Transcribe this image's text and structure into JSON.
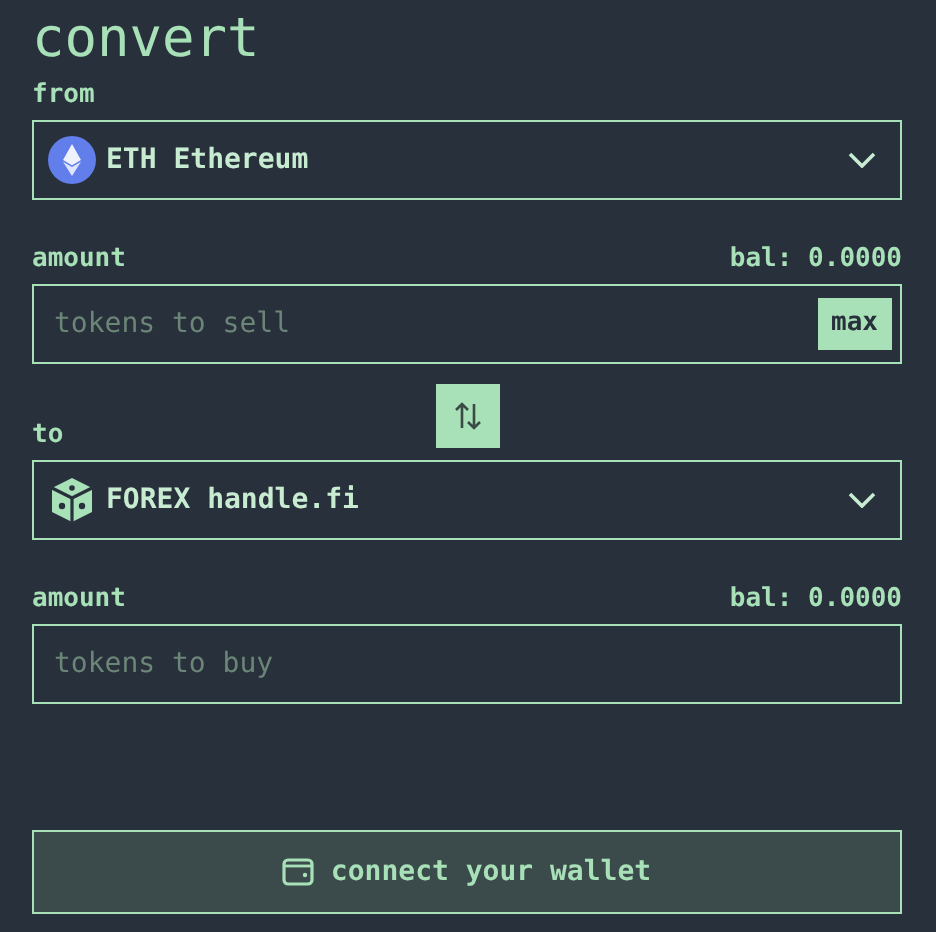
{
  "title": "convert",
  "from": {
    "label": "from",
    "token": {
      "symbol": "ETH",
      "name": "Ethereum",
      "kind": "eth"
    }
  },
  "sell": {
    "label": "amount",
    "balance": "bal: 0.0000",
    "placeholder": "tokens to sell",
    "max_button": "max"
  },
  "to": {
    "label": "to",
    "token": {
      "symbol": "FOREX",
      "name": "handle.fi",
      "kind": "forex"
    }
  },
  "buy": {
    "label": "amount",
    "balance": "bal: 0.0000",
    "placeholder": "tokens to buy"
  },
  "connect_button": "connect your wallet"
}
